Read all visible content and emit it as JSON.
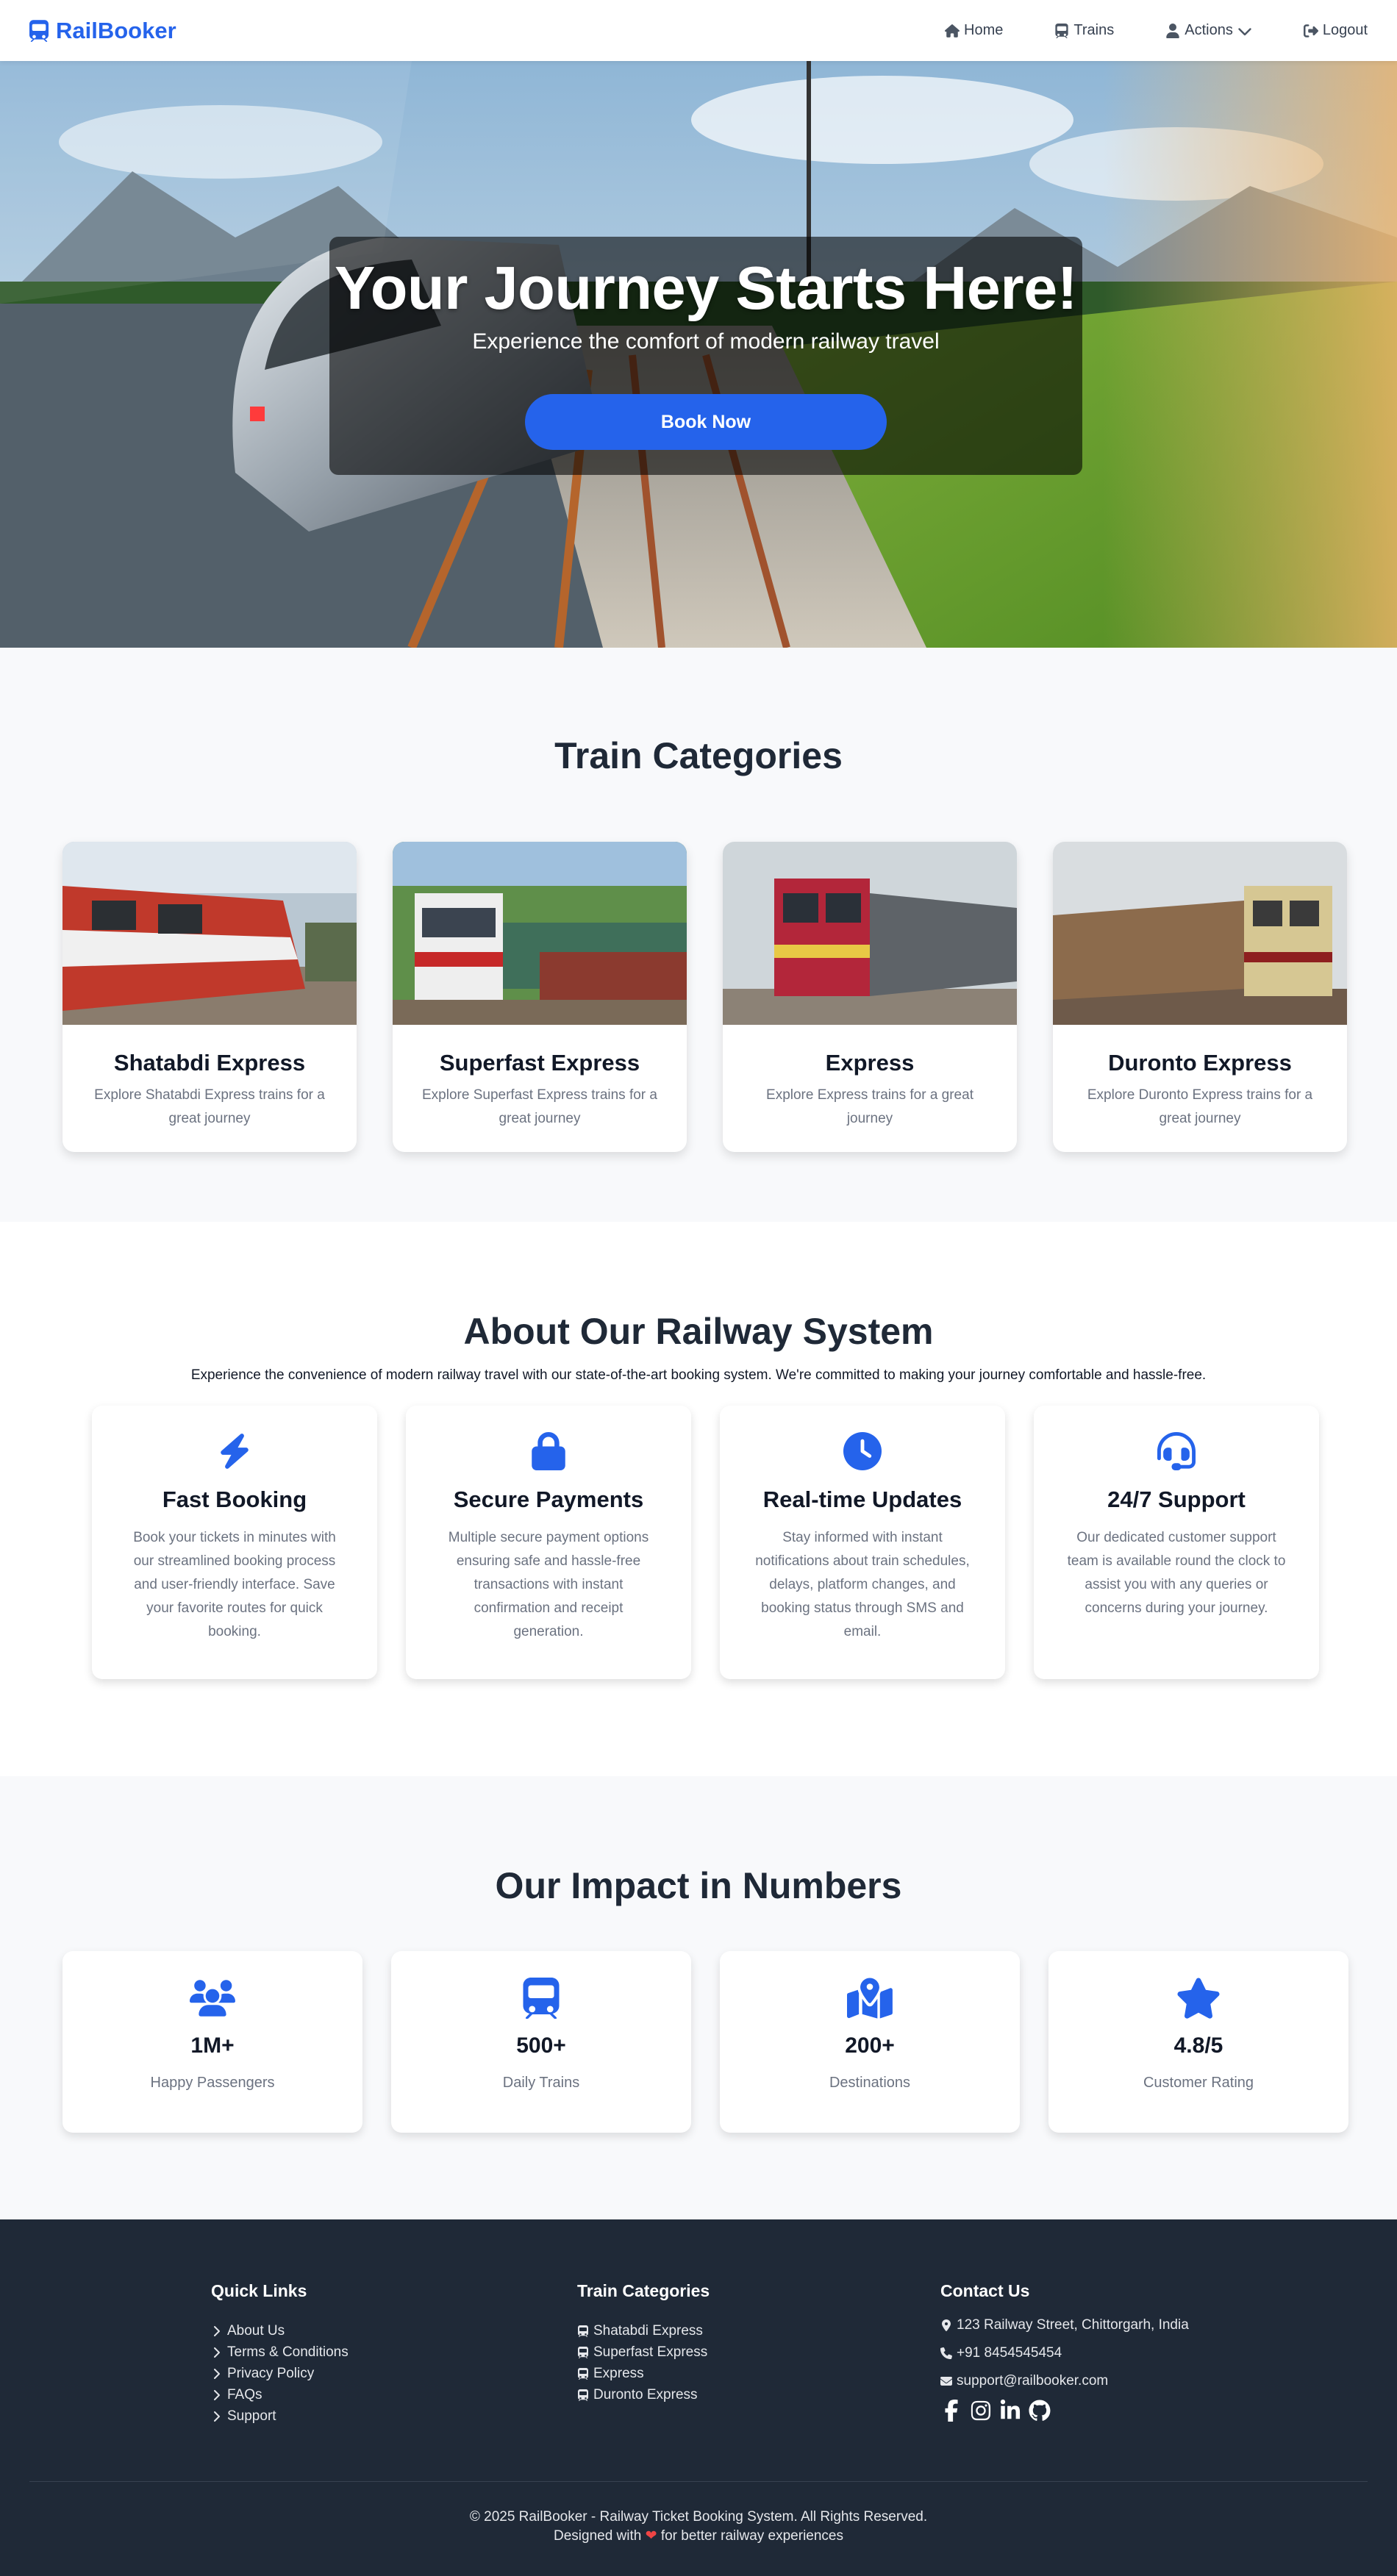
{
  "brand": {
    "name": "RailBooker"
  },
  "nav": {
    "home": "Home",
    "trains": "Trains",
    "actions": "Actions",
    "logout": "Logout"
  },
  "hero": {
    "title": "Your Journey Starts Here!",
    "subtitle": "Experience the comfort of modern railway travel",
    "button": "Book Now"
  },
  "categories": {
    "title": "Train Categories",
    "items": [
      {
        "name": "Shatabdi Express",
        "desc": "Explore Shatabdi Express trains for a great journey"
      },
      {
        "name": "Superfast Express",
        "desc": "Explore Superfast Express trains for a great journey"
      },
      {
        "name": "Express",
        "desc": "Explore Express trains for a great journey"
      },
      {
        "name": "Duronto Express",
        "desc": "Explore Duronto Express trains for a great journey"
      }
    ]
  },
  "about": {
    "title": "About Our Railway System",
    "text": "Experience the convenience of modern railway travel with our state-of-the-art booking system. We're committed to making your journey comfortable and hassle-free.",
    "features": [
      {
        "icon": "bolt-icon",
        "title": "Fast Booking",
        "desc": "Book your tickets in minutes with our streamlined booking process and user-friendly interface. Save your favorite routes for quick booking."
      },
      {
        "icon": "lock-icon",
        "title": "Secure Payments",
        "desc": "Multiple secure payment options ensuring safe and hassle-free transactions with instant confirmation and receipt generation."
      },
      {
        "icon": "clock-icon",
        "title": "Real-time Updates",
        "desc": "Stay informed with instant notifications about train schedules, delays, platform changes, and booking status through SMS and email."
      },
      {
        "icon": "headset-icon",
        "title": "24/7 Support",
        "desc": "Our dedicated customer support team is available round the clock to assist you with any queries or concerns during your journey."
      }
    ]
  },
  "impact": {
    "title": "Our Impact in Numbers",
    "stats": [
      {
        "icon": "users-icon",
        "value": "1M+",
        "label": "Happy Passengers"
      },
      {
        "icon": "train-icon",
        "value": "500+",
        "label": "Daily Trains"
      },
      {
        "icon": "map-location-icon",
        "value": "200+",
        "label": "Destinations"
      },
      {
        "icon": "star-icon",
        "value": "4.8/5",
        "label": "Customer Rating"
      }
    ]
  },
  "footer": {
    "quick_links": {
      "title": "Quick Links",
      "items": [
        "About Us",
        "Terms & Conditions",
        "Privacy Policy",
        "FAQs",
        "Support"
      ]
    },
    "train_categories": {
      "title": "Train Categories",
      "items": [
        "Shatabdi Express",
        "Superfast Express",
        "Express",
        "Duronto Express"
      ]
    },
    "contact": {
      "title": "Contact Us",
      "address": "123 Railway Street, Chittorgarh, India",
      "phone": "+91 8454545454",
      "email": "support@railbooker.com"
    },
    "social": [
      "facebook-icon",
      "instagram-icon",
      "linkedin-icon",
      "github-icon"
    ],
    "copyright": "© 2025 RailBooker - Railway Ticket Booking System. All Rights Reserved.",
    "designed_prefix": "Designed with",
    "designed_suffix": "for better railway experiences"
  },
  "colors": {
    "accent": "#2563eb",
    "footer_bg": "#1f2937",
    "section_alt_bg": "#f8f9fb"
  }
}
